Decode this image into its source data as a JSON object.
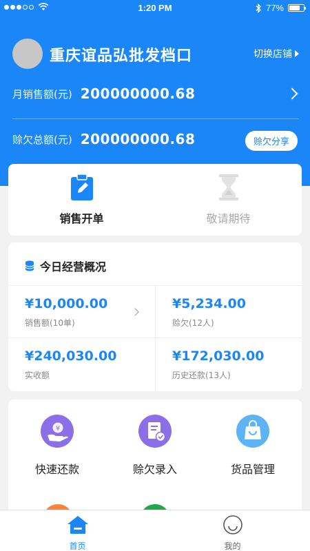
{
  "status": {
    "time": "1:20 PM",
    "battery": "77%",
    "battery_level": 0.77
  },
  "header": {
    "shop_name": "重庆谊品弘批发档口",
    "switch_label": "切换店铺",
    "monthly_sales_label": "月销售额(元)",
    "monthly_sales_value": "200000000.68",
    "debt_label": "赊欠总额(元)",
    "debt_value": "200000000.68",
    "share_label": "赊欠分享"
  },
  "actions": [
    {
      "label": "销售开单"
    },
    {
      "label": "敬请期待"
    }
  ],
  "today": {
    "title": "今日经营概况",
    "stats": [
      {
        "amount": "¥10,000.00",
        "label": "销售额(10单)"
      },
      {
        "amount": "¥5,234.00",
        "label": "赊欠(12人)"
      },
      {
        "amount": "¥240,030.00",
        "label": "实收额"
      },
      {
        "amount": "¥172,030.00",
        "label": "历史还款(13人)"
      }
    ]
  },
  "tools": [
    {
      "label": "快速还款"
    },
    {
      "label": "赊欠录入"
    },
    {
      "label": "货品管理"
    }
  ],
  "tabs": [
    {
      "label": "首页"
    },
    {
      "label": "我的"
    }
  ],
  "colors": {
    "primary": "#1a86f7",
    "background": "#f2f2f2",
    "purple": "#8b6fe6",
    "light_blue": "#5db4f5",
    "orange": "#f5843f",
    "green": "#22a84a"
  }
}
